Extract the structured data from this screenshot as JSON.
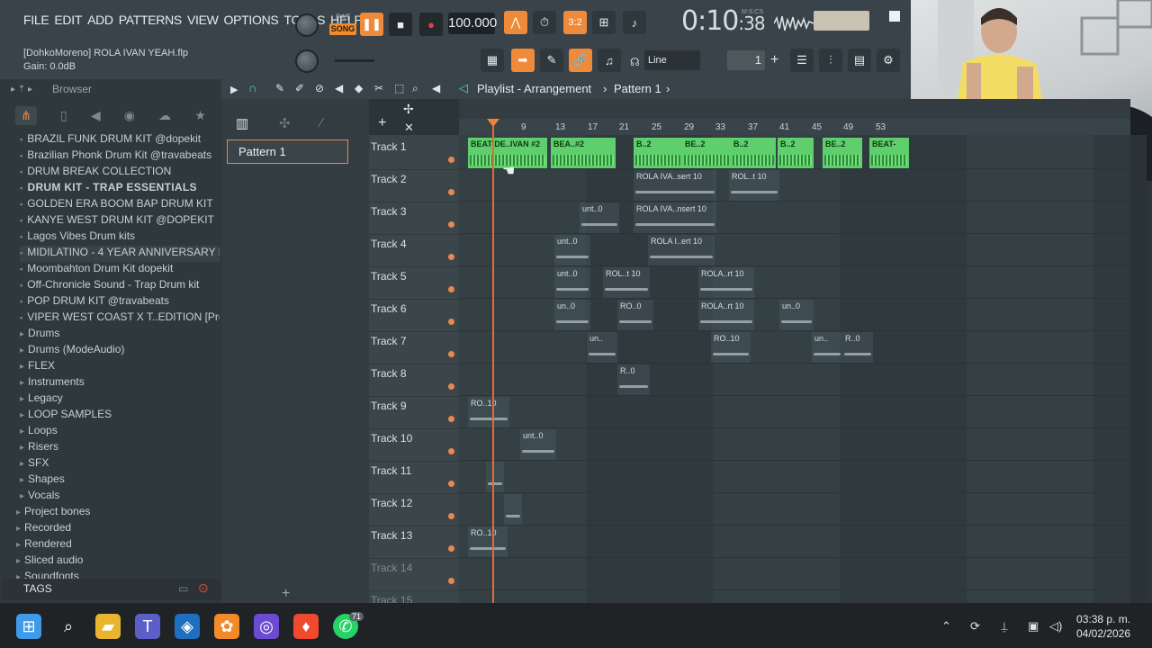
{
  "menu": [
    "FILE",
    "EDIT",
    "ADD",
    "PATTERNS",
    "VIEW",
    "OPTIONS",
    "TOOLS",
    "HELP"
  ],
  "transport": {
    "pat": "PAT",
    "song": "SONG",
    "tempo": "100.000",
    "time_main": "0:10",
    "time_sub": ":38",
    "time_mode": "M:S:CS"
  },
  "project": {
    "file": "[DohkoMoreno] ROLA IVAN YEAH.flp",
    "gain": "Gain: 0.0dB"
  },
  "snap": {
    "mode": "Line",
    "value": "1"
  },
  "browser": {
    "title": "Browser",
    "items": [
      "BRAZIL FUNK DRUM KIT @dopekit",
      "Brazilian Phonk Drum Kit @travabeats",
      "DRUM BREAK COLLECTION",
      "DRUM KIT - TRAP ESSENTIALS",
      "GOLDEN ERA BOOM BAP DRUM KIT",
      "KANYE WEST DRUM KIT @DOPEKIT",
      "Lagos Vibes Drum kits",
      "MIDILATINO - 4 YEAR ANNIVERSARY PREVIEWS",
      "Moombahton Drum Kit dopekit",
      "Off-Chronicle Sound - Trap Drum kit",
      "POP DRUM KIT @travabeats",
      "VIPER WEST COAST X T..EDITION [Prodbymed]",
      "Drums",
      "Drums (ModeAudio)",
      "FLEX",
      "Instruments",
      "Legacy",
      "LOOP SAMPLES",
      "Loops",
      "Risers",
      "SFX",
      "Shapes",
      "Vocals",
      "Project bones",
      "Recorded",
      "Rendered",
      "Sliced audio",
      "Soundfonts"
    ],
    "tags": "TAGS"
  },
  "picker": {
    "pattern": "Pattern 1"
  },
  "playlist": {
    "title": "Playlist - Arrangement",
    "pattern": "Pattern 1",
    "ruler": [
      "9",
      "13",
      "17",
      "21",
      "25",
      "29",
      "33",
      "37",
      "41",
      "45",
      "49",
      "53"
    ],
    "tracks": [
      "Track 1",
      "Track 2",
      "Track 3",
      "Track 4",
      "Track 5",
      "Track 6",
      "Track 7",
      "Track 8",
      "Track 9",
      "Track 10",
      "Track 11",
      "Track 12",
      "Track 13",
      "Track 14",
      "Track 15"
    ],
    "clips": [
      {
        "t": "BEAT-DE..IVAN #2"
      },
      {
        "t": "BEA..#2"
      },
      {
        "t": "B..2"
      },
      {
        "t": "BE..2"
      },
      {
        "t": "B..2"
      },
      {
        "t": "B..2"
      },
      {
        "t": "BE..2"
      },
      {
        "t": "BEAT-"
      },
      {
        "t": "ROLA IVA..sert 10"
      },
      {
        "t": "ROL..t 10"
      },
      {
        "t": "unt..0"
      },
      {
        "t": "ROLA IVA..nsert 10"
      },
      {
        "t": "unt..0"
      },
      {
        "t": "ROLA I..ert 10"
      },
      {
        "t": "unt..0"
      },
      {
        "t": "ROL..t 10"
      },
      {
        "t": "ROLA..rt 10"
      },
      {
        "t": "un..0"
      },
      {
        "t": "RO..0"
      },
      {
        "t": "ROLA..rt 10"
      },
      {
        "t": "un..0"
      },
      {
        "t": "un.."
      },
      {
        "t": "RO..10"
      },
      {
        "t": "un.."
      },
      {
        "t": "R..0"
      },
      {
        "t": "R..0"
      },
      {
        "t": "RO..10"
      },
      {
        "t": "unt..0"
      },
      {
        "t": "RO..10"
      }
    ]
  },
  "taskbar": {
    "time": "03:38 p. m.",
    "date": "04/02/2026",
    "badge": "71"
  }
}
